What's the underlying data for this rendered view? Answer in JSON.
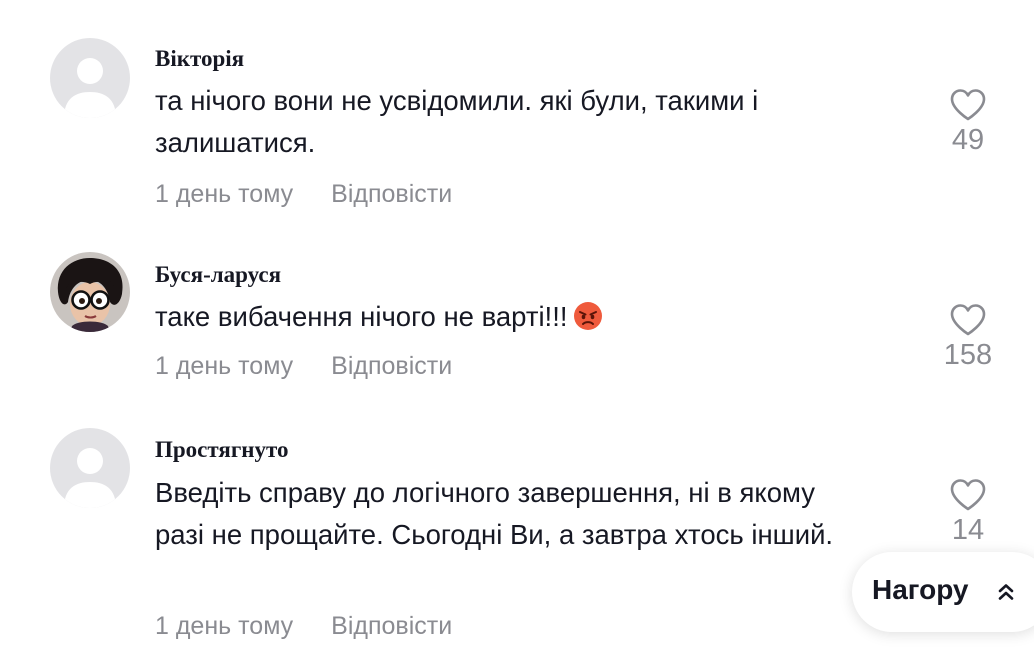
{
  "comments": [
    {
      "username": "Вікторія",
      "avatar": "default-avatar",
      "text": "та нічого вони не усвідомили. які були, такими і залишатися.",
      "time": "1 день тому",
      "reply_label": "Відповісти",
      "likes": "49"
    },
    {
      "username": "Буся-ларуся",
      "avatar": "cartoon-character-avatar",
      "text": "таке вибачення нічого не варті!!!",
      "emoji": "angry-face",
      "time": "1 день тому",
      "reply_label": "Відповісти",
      "likes": "158"
    },
    {
      "username": "Простягнуто",
      "avatar": "default-avatar",
      "text": "Введіть справу до логічного завершення, ні в якому разі не прощайте. Сьогодні Ви, а завтра хтось інший.",
      "time": "1 день тому",
      "reply_label": "Відповісти",
      "likes": "14"
    }
  ],
  "back_to_top": {
    "label": "Нагору",
    "icon": "double-chevron-up-icon"
  },
  "colors": {
    "text": "#161823",
    "secondary": "#8a8b91",
    "avatar_bg": "#e3e3e6",
    "avatar_fg": "#ffffff"
  }
}
